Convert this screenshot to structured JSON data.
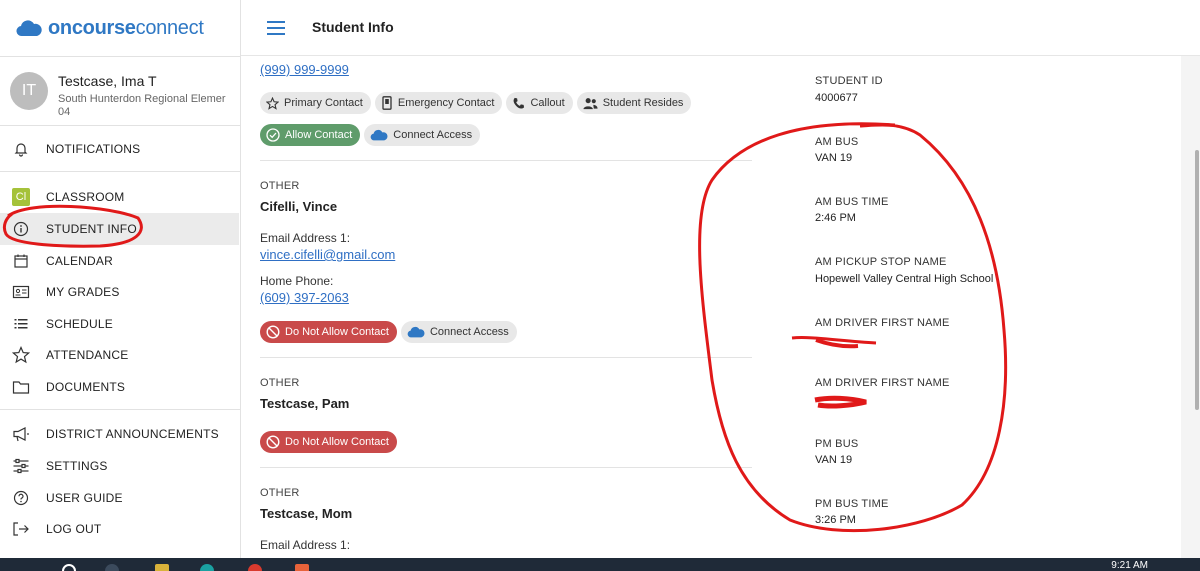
{
  "logo": {
    "bold": "oncourse",
    "light": "connect"
  },
  "user": {
    "initials": "IT",
    "name": "Testcase, Ima T",
    "school": "South Hunterdon Regional Elemer",
    "school_line2": "04"
  },
  "nav": [
    {
      "label": "NOTIFICATIONS",
      "icon": "bell-icon"
    },
    {
      "label": "CLASSROOM",
      "icon": "classroom-icon",
      "badge": "Cl"
    },
    {
      "label": "STUDENT INFO",
      "icon": "info-icon",
      "active": true
    },
    {
      "label": "CALENDAR",
      "icon": "calendar-icon"
    },
    {
      "label": "MY GRADES",
      "icon": "grades-icon"
    },
    {
      "label": "SCHEDULE",
      "icon": "schedule-icon"
    },
    {
      "label": "ATTENDANCE",
      "icon": "star-icon"
    },
    {
      "label": "DOCUMENTS",
      "icon": "folder-icon"
    },
    {
      "label": "DISTRICT ANNOUNCEMENTS",
      "icon": "megaphone-icon"
    },
    {
      "label": "SETTINGS",
      "icon": "sliders-icon"
    },
    {
      "label": "USER GUIDE",
      "icon": "help-icon"
    },
    {
      "label": "LOG OUT",
      "icon": "logout-icon"
    }
  ],
  "header": {
    "title": "Student Info"
  },
  "contacts": {
    "top_phone": "(999) 999-9999",
    "top_chips": [
      "Primary Contact",
      "Emergency Contact",
      "Callout",
      "Student Resides"
    ],
    "top_allow": "Allow Contact",
    "connect_access": "Connect Access",
    "c1": {
      "type": "OTHER",
      "name": "Cifelli, Vince",
      "email_label": "Email Address 1:",
      "email": "vince.cifelli@gmail.com",
      "phone_label": "Home Phone:",
      "phone": "(609) 397-2063",
      "status": "Do Not Allow Contact"
    },
    "c2": {
      "type": "OTHER",
      "name": "Testcase, Pam",
      "status": "Do Not Allow Contact"
    },
    "c3": {
      "type": "OTHER",
      "name": "Testcase, Mom",
      "email_label": "Email Address 1:"
    }
  },
  "details": [
    {
      "label": "STUDENT ID",
      "value": "4000677"
    },
    {
      "label": "AM BUS",
      "value": "VAN 19"
    },
    {
      "label": "AM BUS TIME",
      "value": "2:46 PM"
    },
    {
      "label": "AM PICKUP STOP NAME",
      "value": "Hopewell Valley Central High School"
    },
    {
      "label": "AM DRIVER FIRST NAME",
      "value": ""
    },
    {
      "label": "AM DRIVER FIRST NAME",
      "value": ""
    },
    {
      "label": "PM BUS",
      "value": "VAN 19"
    },
    {
      "label": "PM BUS TIME",
      "value": "3:26 PM"
    }
  ],
  "taskbar": {
    "time": "9:21 AM"
  },
  "colors": {
    "brand": "#2f78c4",
    "allow": "#5f9c6b",
    "deny": "#c94a4a",
    "annotation": "#e01919"
  }
}
